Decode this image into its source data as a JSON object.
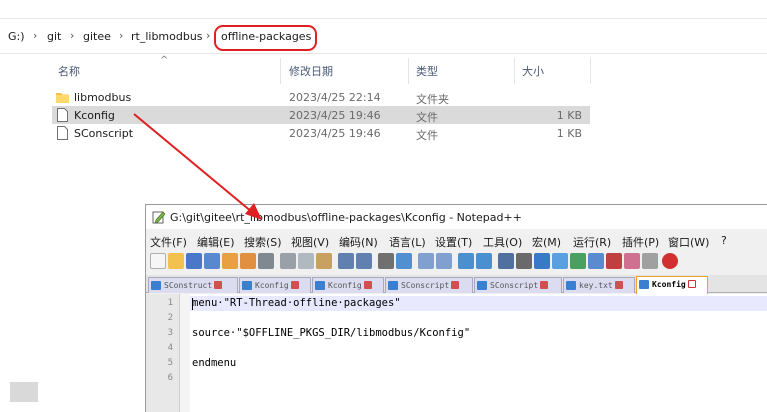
{
  "explorer": {
    "breadcrumb": [
      "G:)",
      "git",
      "gitee",
      "rt_libmodbus",
      "offline-packages"
    ],
    "separator": "›",
    "columns": {
      "name": "名称",
      "date": "修改日期",
      "type": "类型",
      "size": "大小"
    },
    "sort_indicator": "^",
    "files": [
      {
        "name": "libmodbus",
        "date": "2023/4/25 22:14",
        "type": "文件夹",
        "size": "",
        "icon": "folder-icon",
        "selected": false
      },
      {
        "name": "Kconfig",
        "date": "2023/4/25 19:46",
        "type": "文件",
        "size": "1 KB",
        "icon": "file-icon",
        "selected": true
      },
      {
        "name": "SConscript",
        "date": "2023/4/25 19:46",
        "type": "文件",
        "size": "1 KB",
        "icon": "file-icon",
        "selected": false
      }
    ]
  },
  "notepad": {
    "title": "G:\\git\\gitee\\rt_libmodbus\\offline-packages\\Kconfig - Notepad++",
    "menu": [
      "文件(F)",
      "编辑(E)",
      "搜索(S)",
      "视图(V)",
      "编码(N)",
      "语言(L)",
      "设置(T)",
      "工具(O)",
      "宏(M)",
      "运行(R)",
      "插件(P)",
      "窗口(W)",
      "?"
    ],
    "tabs": [
      {
        "label": "SConstruct",
        "active": false
      },
      {
        "label": "Kconfig",
        "active": false
      },
      {
        "label": "Kconfig",
        "active": false
      },
      {
        "label": "SConscript",
        "active": false
      },
      {
        "label": "SConscript",
        "active": false
      },
      {
        "label": "key.txt",
        "active": false
      },
      {
        "label": "Kconfig",
        "active": true
      }
    ],
    "line_numbers": [
      "1",
      "2",
      "3",
      "4",
      "5",
      "6"
    ],
    "code_lines": [
      "menu·\"RT-Thread·offline·packages\"",
      "",
      "source·\"$OFFLINE_PKGS_DIR/libmodbus/Kconfig\"",
      "",
      "endmenu",
      ""
    ]
  },
  "colors": {
    "highlight_border": "#e02020",
    "arrow": "#e02020",
    "selected_row": "#dadada",
    "current_line": "#e8e8ff"
  }
}
